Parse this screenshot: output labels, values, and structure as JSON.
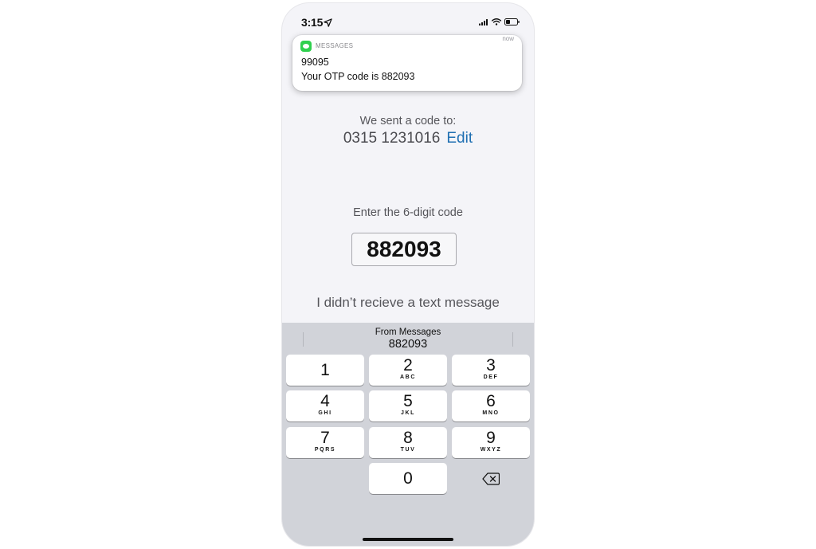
{
  "status_bar": {
    "time": "3:15"
  },
  "notification": {
    "app_name": "MESSAGES",
    "time": "now",
    "sender": "99095",
    "body": "Your OTP code is 882093"
  },
  "verification": {
    "sent_label": "We sent a code to:",
    "phone_number": "0315 1231016",
    "edit_label": "Edit",
    "enter_label": "Enter the 6-digit code",
    "code_value": "882093",
    "resend_label": "I didn’t recieve a text message"
  },
  "keyboard": {
    "suggestion_source": "From Messages",
    "suggestion_code": "882093",
    "keys": [
      {
        "digit": "1",
        "letters": ""
      },
      {
        "digit": "2",
        "letters": "ABC"
      },
      {
        "digit": "3",
        "letters": "DEF"
      },
      {
        "digit": "4",
        "letters": "GHI"
      },
      {
        "digit": "5",
        "letters": "JKL"
      },
      {
        "digit": "6",
        "letters": "MNO"
      },
      {
        "digit": "7",
        "letters": "PQRS"
      },
      {
        "digit": "8",
        "letters": "TUV"
      },
      {
        "digit": "9",
        "letters": "WXYZ"
      },
      {
        "digit": "0",
        "letters": ""
      }
    ]
  },
  "icons": {
    "location": "location-arrow-icon",
    "signal": "cellular-signal-icon",
    "wifi": "wifi-icon",
    "battery": "battery-icon",
    "app": "messages-app-icon",
    "backspace": "backspace-icon"
  }
}
